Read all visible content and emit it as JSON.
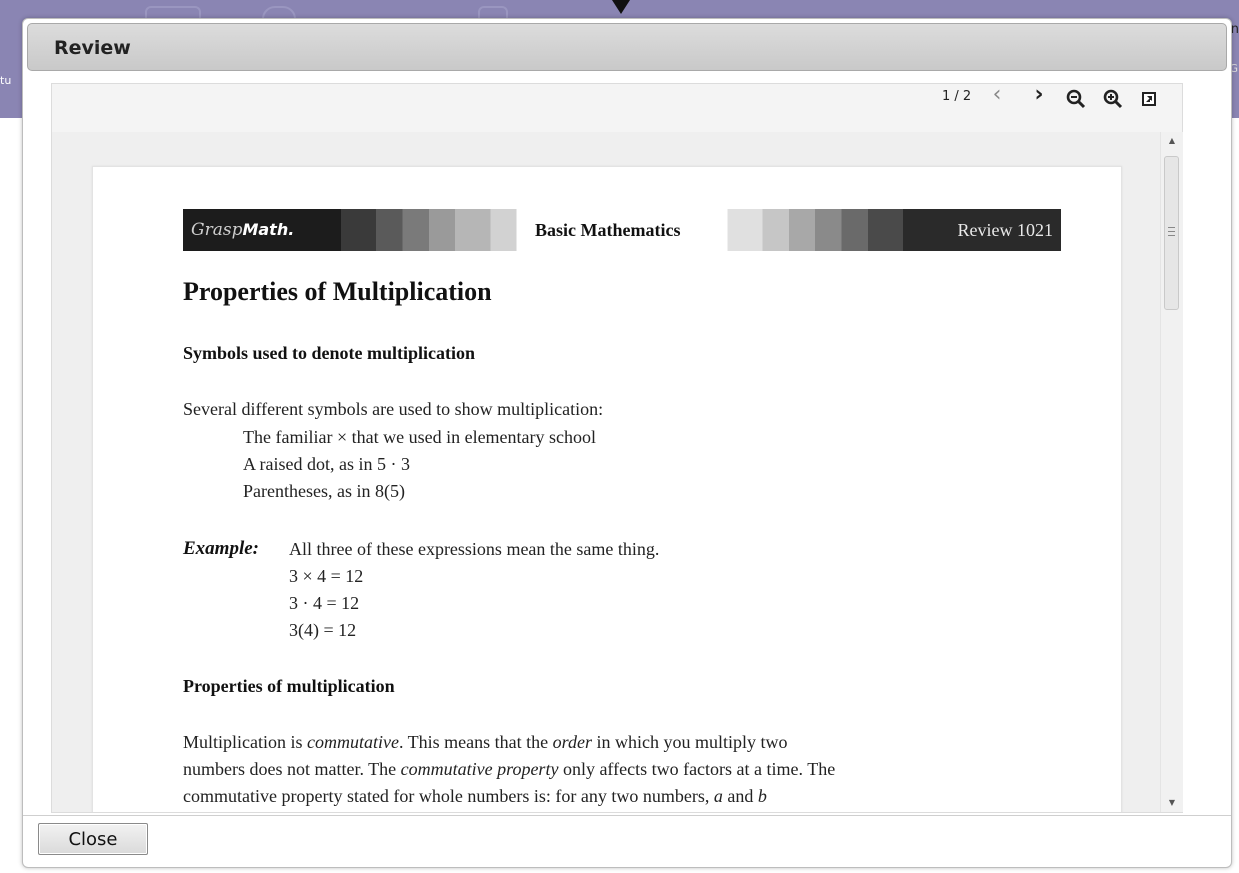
{
  "background": {
    "right_text": "n",
    "left_text": "tu",
    "right_small_text": "G"
  },
  "dialog": {
    "title": "Review",
    "close_label": "Close"
  },
  "viewer": {
    "page_indicator": "1 / 2",
    "prev_glyph": "‹",
    "next_glyph": "›",
    "icons": [
      "chevron-left-icon",
      "chevron-right-icon",
      "zoom-out-icon",
      "zoom-in-icon",
      "popout-icon"
    ]
  },
  "document": {
    "banner": {
      "logo_grasp": "Grasp",
      "logo_math": "Math.",
      "center": "Basic Mathematics",
      "right": "Review 1021"
    },
    "title": "Properties of Multiplication",
    "section1_heading": "Symbols used to denote multiplication",
    "section1_intro": "Several different symbols are used to show multiplication:",
    "section1_items": [
      "The familiar × that we used in elementary school",
      "A raised dot, as in 5 · 3",
      "Parentheses, as in 8(5)"
    ],
    "example_label": "Example:",
    "example_text": "All three of these expressions mean the same thing.",
    "example_lines": [
      "3 × 4 = 12",
      "3 · 4 = 12",
      "3(4) = 12"
    ],
    "section2_heading": "Properties of multiplication",
    "para_line1_pre": "Multiplication is ",
    "para_line1_em1": "commutative",
    "para_line1_mid": ".  This means that the ",
    "para_line1_em2": "order",
    "para_line1_post": " in which you multiply two",
    "para_line2_pre": "numbers does not matter.  The ",
    "para_line2_em": "commutative property",
    "para_line2_post": " only affects two factors at a time.  The",
    "para_line3_pre": "commutative property stated for whole numbers is: for any two numbers, ",
    "para_line3_a": "a",
    "para_line3_and": " and ",
    "para_line3_b": "b"
  }
}
